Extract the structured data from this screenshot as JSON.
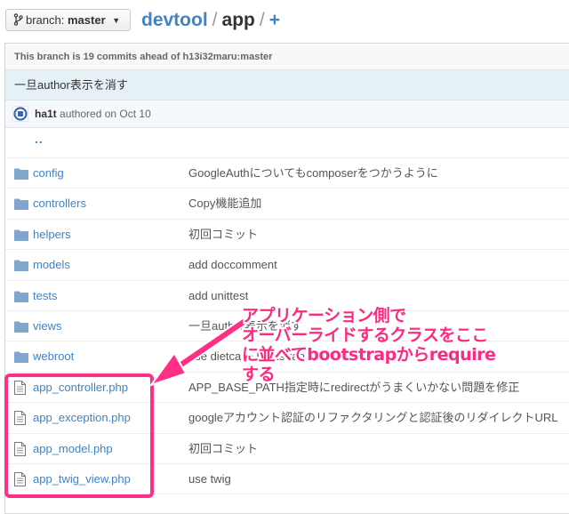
{
  "header": {
    "branch_label": "branch:",
    "branch_value": "master",
    "repo": "devtool",
    "separator": "/",
    "current_dir": "app",
    "add_label": "+"
  },
  "status": {
    "ahead_text": "This branch is 19 commits ahead of h13i32maru:master"
  },
  "commit": {
    "message": "一旦author表示を消す",
    "author": "ha1t",
    "meta": "authored on Oct 10"
  },
  "parent_dir": "..",
  "files": [
    {
      "name": "config",
      "type": "folder",
      "message": "GoogleAuthについてもcomposerをつかうように"
    },
    {
      "name": "controllers",
      "type": "folder",
      "message": "Copy機能追加"
    },
    {
      "name": "helpers",
      "type": "folder",
      "message": "初回コミット"
    },
    {
      "name": "models",
      "type": "folder",
      "message": "add doccomment"
    },
    {
      "name": "tests",
      "type": "folder",
      "message": "add unittest"
    },
    {
      "name": "views",
      "type": "folder",
      "message": "一旦author表示を消す"
    },
    {
      "name": "webroot",
      "type": "folder",
      "message": "use dietcake bootstrap"
    },
    {
      "name": "app_controller.php",
      "type": "file",
      "message": "APP_BASE_PATH指定時にredirectがうまくいかない問題を修正"
    },
    {
      "name": "app_exception.php",
      "type": "file",
      "message": "googleアカウント認証のリファクタリングと認証後のリダイレクトURL"
    },
    {
      "name": "app_model.php",
      "type": "file",
      "message": "初回コミット"
    },
    {
      "name": "app_twig_view.php",
      "type": "file",
      "message": "use twig"
    }
  ],
  "annotation": {
    "lines": [
      "アプリケーション側で",
      "オーバーライドするクラスをここ",
      "に並べてbootstrapからrequire",
      "する"
    ]
  },
  "colors": {
    "link": "#4183c4",
    "annotation": "#ff2a80",
    "commit_bg": "#e6f1f6",
    "folder_icon": "#80a6cd"
  },
  "icons": {
    "branch": "branch-icon",
    "folder": "folder-icon",
    "file": "file-icon",
    "avatar": "avatar-identicon"
  }
}
